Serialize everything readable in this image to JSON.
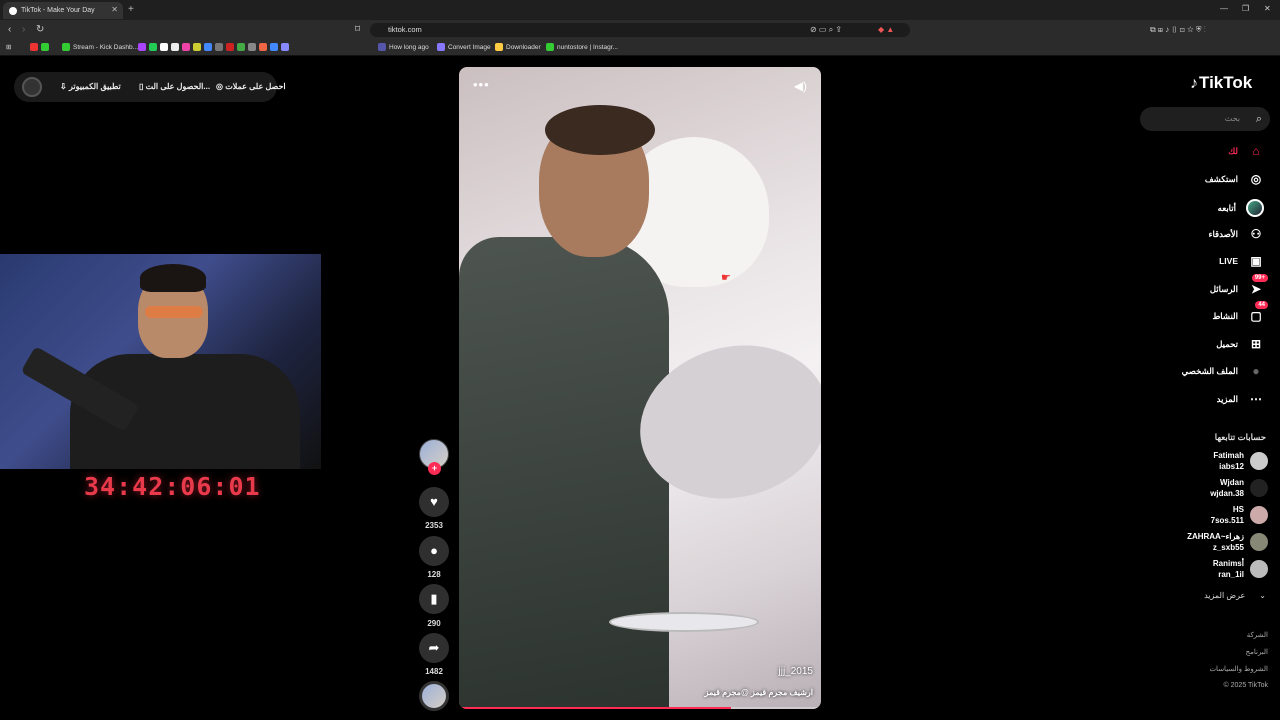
{
  "browser": {
    "tab_title": "TikTok - Make Your Day",
    "url": "tiktok.com",
    "bookmarks": [
      "Stream - Kick Dashb...",
      "How long ago",
      "Convert Image",
      "Downloader",
      "nuntostore | Instagr..."
    ]
  },
  "top_pill": {
    "get_coins": "احصل على عملات",
    "get_on": "الحصول على الت...",
    "computer_app": "تطبيق الكمبيوتر"
  },
  "stream": {
    "timer": "34:42:06:01"
  },
  "video": {
    "more": "•••",
    "username": "jjj_2015",
    "caption": "ارشيف مجرم قيمز @مجرم قيمز",
    "progress": 0.75
  },
  "actions": {
    "likes": "2353",
    "comments": "128",
    "saves": "290",
    "shares": "1482"
  },
  "sidebar": {
    "logo": "TikTok",
    "search_placeholder": "بحث",
    "nav": [
      {
        "label": "لك",
        "icon": "home-icon"
      },
      {
        "label": "استكشف",
        "icon": "explore-icon"
      },
      {
        "label": "أتابعه",
        "icon": "following-avatar"
      },
      {
        "label": "الأصدقاء",
        "icon": "friends-icon"
      },
      {
        "label": "LIVE",
        "icon": "live-icon"
      },
      {
        "label": "الرسائل",
        "icon": "messages-icon",
        "badge": "99+"
      },
      {
        "label": "النشاط",
        "icon": "activity-icon",
        "badge": "44"
      },
      {
        "label": "تحميل",
        "icon": "upload-icon"
      },
      {
        "label": "الملف الشخصي",
        "icon": "profile-icon"
      },
      {
        "label": "المزيد",
        "icon": "more-icon"
      }
    ],
    "following_header": "حسابات تتابعها",
    "accounts": [
      {
        "name": "Fatimah",
        "handle": "iabs12"
      },
      {
        "name": "Wjdan",
        "handle": "wjdan.38"
      },
      {
        "name": "HS",
        "handle": "7sos.511"
      },
      {
        "name": "ZAHRAA~زهراء",
        "handle": "z_sxb55"
      },
      {
        "name": "Ranimsأ",
        "handle": "ran_1il"
      }
    ],
    "see_more": "عرض المزيد",
    "footer": [
      "الشركة",
      "البرنامج",
      "الشروط والسياسات",
      "© 2025 TikTok"
    ]
  }
}
